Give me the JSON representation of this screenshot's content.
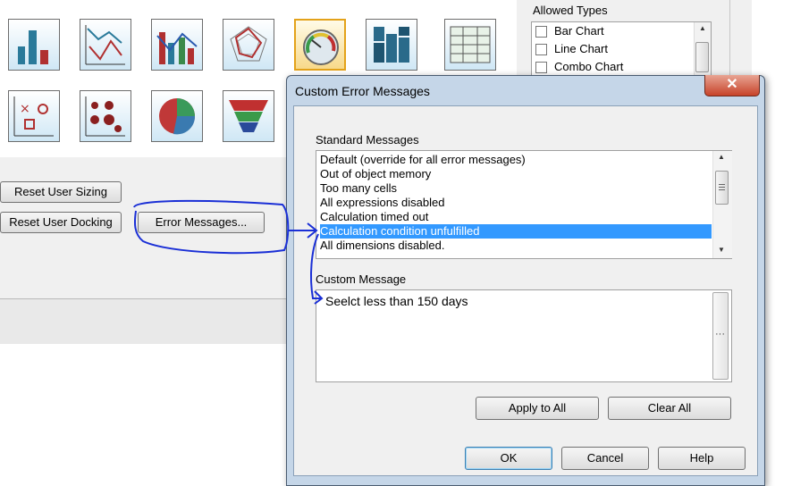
{
  "background": {
    "buttons": {
      "reset_user_sizing": "Reset User Sizing",
      "reset_user_docking": "Reset User Docking",
      "error_messages": "Error Messages..."
    },
    "chart_tiles": [
      {
        "name": "bar-chart-icon",
        "selected": false
      },
      {
        "name": "line-chart-icon",
        "selected": false
      },
      {
        "name": "combo-chart-icon",
        "selected": false
      },
      {
        "name": "radar-chart-icon",
        "selected": false
      },
      {
        "name": "gauge-chart-icon",
        "selected": true
      },
      {
        "name": "mekko-chart-icon",
        "selected": false
      },
      {
        "name": "pivot-table-icon",
        "selected": false
      },
      {
        "name": "scatter-chart-icon",
        "selected": false
      },
      {
        "name": "grid-chart-icon",
        "selected": false
      },
      {
        "name": "pie-chart-icon",
        "selected": false
      },
      {
        "name": "funnel-chart-icon",
        "selected": false
      }
    ]
  },
  "allowed_types": {
    "title": "Allowed Types",
    "items": [
      "Bar Chart",
      "Line Chart",
      "Combo Chart"
    ]
  },
  "dialog": {
    "title": "Custom Error Messages",
    "close_icon": "close-icon",
    "standard_messages_label": "Standard Messages",
    "standard_messages": [
      "Default (override for all error messages)",
      "Out of object memory",
      "Too many cells",
      "All expressions disabled",
      "Calculation timed out",
      "Calculation condition unfulfilled",
      "All dimensions disabled."
    ],
    "selected_message": "Calculation condition unfulfilled",
    "custom_message_label": "Custom Message",
    "custom_message_value": "Seelct less than 150 days",
    "buttons": {
      "apply_to_all": "Apply to All",
      "clear_all": "Clear All",
      "ok": "OK",
      "cancel": "Cancel",
      "help": "Help"
    }
  },
  "colors": {
    "selection": "#3399ff",
    "annotation": "#1a2fd6",
    "dialog_frame": "#c5d6e8",
    "close_button": "#c7432a"
  }
}
